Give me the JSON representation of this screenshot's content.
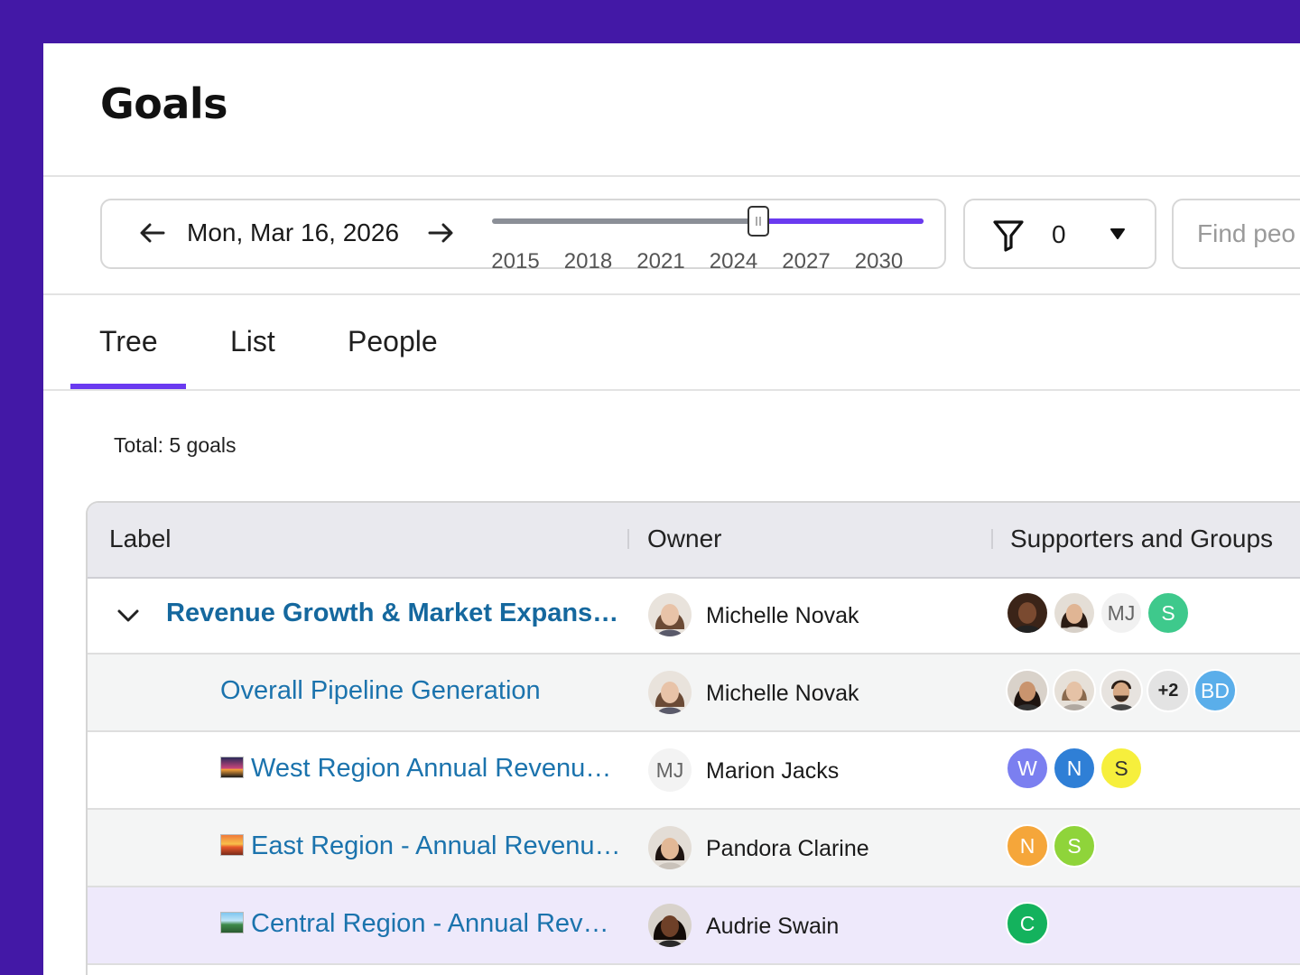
{
  "page": {
    "title": "Goals"
  },
  "date_range": {
    "current_date": "Mon, Mar 16, 2026",
    "year_ticks": [
      "2015",
      "2018",
      "2021",
      "2024",
      "2027",
      "2030"
    ],
    "selected_position_fraction": 0.617,
    "track_color": "#8b8f97",
    "range_color": "#6a3af0"
  },
  "filter": {
    "count": "0"
  },
  "search": {
    "placeholder": "Find peo"
  },
  "tabs": [
    {
      "label": "Tree",
      "active": true
    },
    {
      "label": "List",
      "active": false
    },
    {
      "label": "People",
      "active": false
    }
  ],
  "summary": {
    "total": "Total: 5 goals"
  },
  "table": {
    "columns": [
      "Label",
      "Owner",
      "Supporters and Groups"
    ],
    "rows": [
      {
        "label": "Revenue Growth & Market Expans…",
        "owner": "Michelle Novak",
        "supporters": [
          {
            "type": "photo",
            "name": "supporter-photo"
          },
          {
            "type": "photo",
            "name": "supporter-photo"
          },
          {
            "type": "initials",
            "text": "MJ",
            "color": "#f1f1f1",
            "text_color": "#666"
          },
          {
            "type": "initials",
            "text": "S",
            "color": "#3ec98c",
            "text_color": "#ffffff"
          }
        ]
      },
      {
        "label": "Overall Pipeline Generation",
        "owner": "Michelle Novak",
        "supporters": [
          {
            "type": "photo",
            "name": "supporter-photo"
          },
          {
            "type": "photo",
            "name": "supporter-photo"
          },
          {
            "type": "photo",
            "name": "supporter-photo"
          },
          {
            "type": "more",
            "text": "+2",
            "color": "#e3e3e3",
            "text_color": "#222"
          },
          {
            "type": "initials",
            "text": "BD",
            "color": "#5aaeea",
            "text_color": "#ffffff"
          }
        ]
      },
      {
        "label": "West Region Annual Revenu…",
        "owner": "Marion Jacks",
        "owner_initials": "MJ",
        "supporters": [
          {
            "type": "initials",
            "text": "W",
            "color": "#7b7ff0",
            "text_color": "#ffffff"
          },
          {
            "type": "initials",
            "text": "N",
            "color": "#2f7fd6",
            "text_color": "#ffffff"
          },
          {
            "type": "initials",
            "text": "S",
            "color": "#f6ef3c",
            "text_color": "#333"
          }
        ]
      },
      {
        "label": "East Region - Annual Revenu…",
        "owner": "Pandora Clarine",
        "supporters": [
          {
            "type": "initials",
            "text": "N",
            "color": "#f5a63a",
            "text_color": "#ffffff"
          },
          {
            "type": "initials",
            "text": "S",
            "color": "#8fd43a",
            "text_color": "#ffffff"
          }
        ]
      },
      {
        "label": "Central Region - Annual Rev…",
        "owner": "Audrie Swain",
        "supporters": [
          {
            "type": "initials",
            "text": "C",
            "color": "#14b25d",
            "text_color": "#ffffff"
          }
        ]
      }
    ]
  }
}
